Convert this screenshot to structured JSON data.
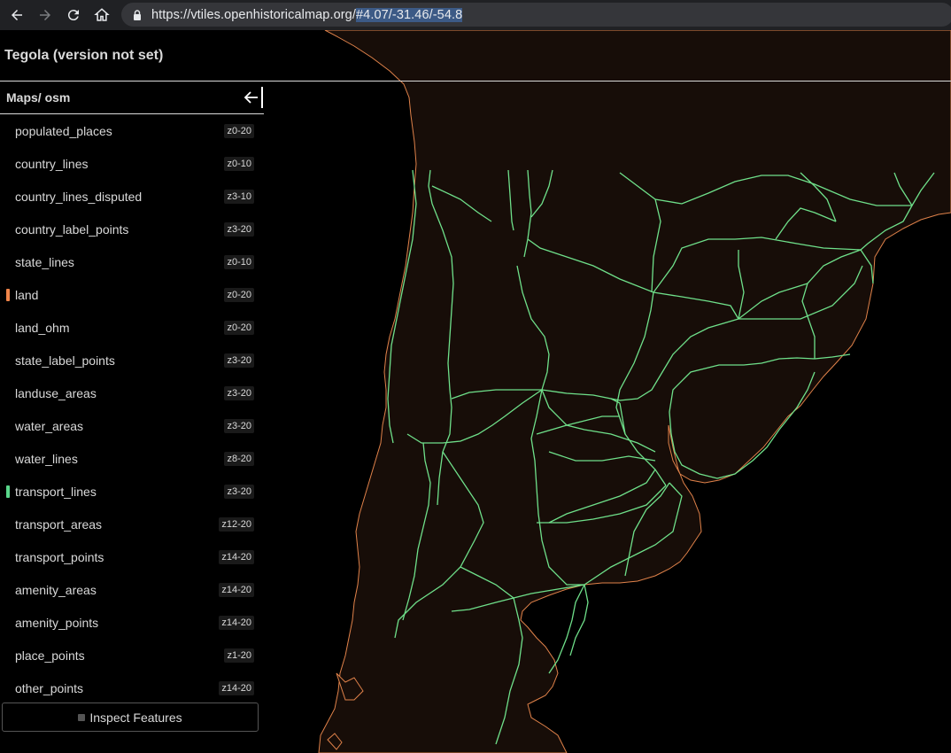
{
  "browser": {
    "url_base": "https://vtiles.openhistoricalmap.org/",
    "url_hash": "#4.07/-31.46/-54.8"
  },
  "header": {
    "title": "Tegola (version not set)"
  },
  "sidebar": {
    "breadcrumb": "Maps/ osm",
    "layers": [
      {
        "name": "populated_places",
        "zoom": "z0-20",
        "color": ""
      },
      {
        "name": "country_lines",
        "zoom": "z0-10",
        "color": ""
      },
      {
        "name": "country_lines_disputed",
        "zoom": "z3-10",
        "color": ""
      },
      {
        "name": "country_label_points",
        "zoom": "z3-20",
        "color": ""
      },
      {
        "name": "state_lines",
        "zoom": "z0-10",
        "color": ""
      },
      {
        "name": "land",
        "zoom": "z0-20",
        "color": "#f0854a"
      },
      {
        "name": "land_ohm",
        "zoom": "z0-20",
        "color": ""
      },
      {
        "name": "state_label_points",
        "zoom": "z3-20",
        "color": ""
      },
      {
        "name": "landuse_areas",
        "zoom": "z3-20",
        "color": ""
      },
      {
        "name": "water_areas",
        "zoom": "z3-20",
        "color": ""
      },
      {
        "name": "water_lines",
        "zoom": "z8-20",
        "color": ""
      },
      {
        "name": "transport_lines",
        "zoom": "z3-20",
        "color": "#59d68a"
      },
      {
        "name": "transport_areas",
        "zoom": "z12-20",
        "color": ""
      },
      {
        "name": "transport_points",
        "zoom": "z14-20",
        "color": ""
      },
      {
        "name": "amenity_areas",
        "zoom": "z14-20",
        "color": ""
      },
      {
        "name": "amenity_points",
        "zoom": "z14-20",
        "color": ""
      },
      {
        "name": "place_points",
        "zoom": "z1-20",
        "color": ""
      },
      {
        "name": "other_points",
        "zoom": "z14-20",
        "color": ""
      }
    ],
    "inspect_label": "Inspect Features"
  },
  "map": {
    "land_fill": "#170d08",
    "coast_color": "#e0824a",
    "rail_color": "#6fe08a"
  }
}
